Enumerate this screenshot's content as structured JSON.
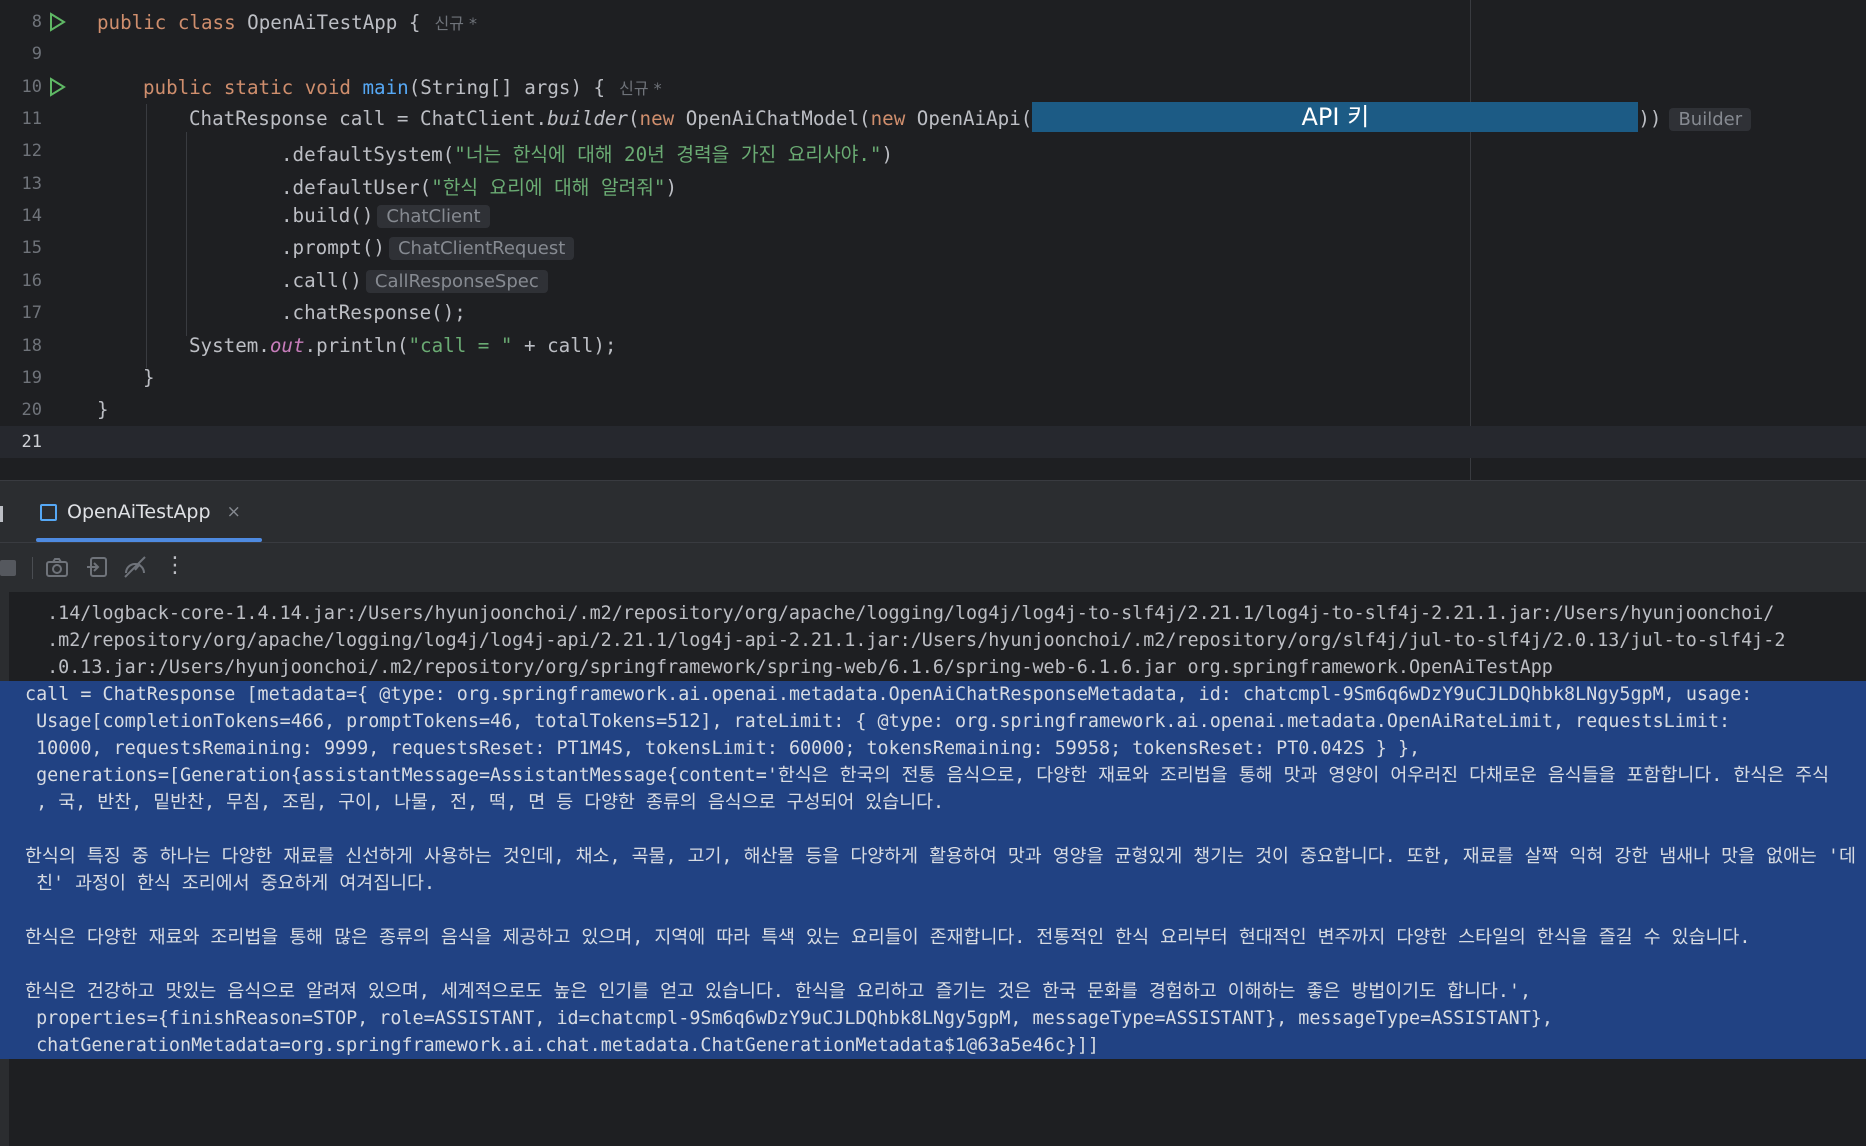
{
  "editor": {
    "lines": [
      {
        "num": "8",
        "run": true
      },
      {
        "num": "9"
      },
      {
        "num": "10",
        "run": true
      },
      {
        "num": "11"
      },
      {
        "num": "12"
      },
      {
        "num": "13"
      },
      {
        "num": "14"
      },
      {
        "num": "15"
      },
      {
        "num": "16"
      },
      {
        "num": "17"
      },
      {
        "num": "18"
      },
      {
        "num": "19"
      },
      {
        "num": "20"
      },
      {
        "num": "21",
        "current": true
      }
    ],
    "code": {
      "l8_kw": "public class",
      "l8_name": " OpenAiTestApp {",
      "l8_tag": "신규 *",
      "l10_kw": "public static void",
      "l10_fn": "main",
      "l10_rest": "(String[] args) {",
      "l10_tag": "신규 *",
      "l11_a": "ChatResponse call = ChatClient.",
      "l11_builder": "builder",
      "l11_b": "(",
      "l11_new1": "new",
      "l11_c": " OpenAiChatModel(",
      "l11_new2": "new",
      "l11_d": " OpenAiApi(",
      "l11_key": "API 키",
      "l11_e": "))",
      "l11_hint": "Builder",
      "l12_a": ".defaultSystem(",
      "l12_str": "\"너는 한식에 대해 20년 경력을 가진 요리사야.\"",
      "l12_b": ")",
      "l13_a": ".defaultUser(",
      "l13_str": "\"한식 요리에 대해 알려줘\"",
      "l13_b": ")",
      "l14_a": ".build()",
      "l14_hint": "ChatClient",
      "l15_a": ".prompt()",
      "l15_hint": "ChatClientRequest",
      "l16_a": ".call()",
      "l16_hint": "CallResponseSpec",
      "l17_a": ".chatResponse();",
      "l18_a": "System.",
      "l18_out": "out",
      "l18_b": ".println(",
      "l18_str": "\"call = \"",
      "l18_c": " + call);",
      "l19": "}",
      "l20": "}"
    }
  },
  "run_panel": {
    "tab_label": "OpenAiTestApp",
    "tab_close": "×",
    "toolbar_icons": [
      "stop-icon",
      "camera-icon",
      "exit-icon",
      "profiler-icon",
      "more-icon"
    ],
    "more_glyph": "⋮"
  },
  "console": {
    "lines": [
      {
        "text": " .14/logback-core-1.4.14.jar:/Users/hyunjoonchoi/.m2/repository/org/apache/logging/log4j/log4j-to-slf4j/2.21.1/log4j-to-slf4j-2.21.1.jar:/Users/hyunjoonchoi/",
        "sel": false
      },
      {
        "text": " .m2/repository/org/apache/logging/log4j/log4j-api/2.21.1/log4j-api-2.21.1.jar:/Users/hyunjoonchoi/.m2/repository/org/slf4j/jul-to-slf4j/2.0.13/jul-to-slf4j-2",
        "sel": false
      },
      {
        "text": " .0.13.jar:/Users/hyunjoonchoi/.m2/repository/org/springframework/spring-web/6.1.6/spring-web-6.1.6.jar org.springframework.OpenAiTestApp",
        "sel": false
      },
      {
        "text": "call = ChatResponse [metadata={ @type: org.springframework.ai.openai.metadata.OpenAiChatResponseMetadata, id: chatcmpl-9Sm6q6wDzY9uCJLDQhbk8LNgy5gpM, usage:",
        "sel": true
      },
      {
        "text": " Usage[completionTokens=466, promptTokens=46, totalTokens=512], rateLimit: { @type: org.springframework.ai.openai.metadata.OpenAiRateLimit, requestsLimit:",
        "sel": true
      },
      {
        "text": " 10000, requestsRemaining: 9999, requestsReset: PT1M4S, tokensLimit: 60000; tokensRemaining: 59958; tokensReset: PT0.042S } },",
        "sel": true
      },
      {
        "text": " generations=[Generation{assistantMessage=AssistantMessage{content='한식은 한국의 전통 음식으로, 다양한 재료와 조리법을 통해 맛과 영양이 어우러진 다채로운 음식들을 포함합니다. 한식은 주식",
        "sel": true
      },
      {
        "text": " , 국, 반찬, 밑반찬, 무침, 조림, 구이, 나물, 전, 떡, 면 등 다양한 종류의 음식으로 구성되어 있습니다.",
        "sel": true
      },
      {
        "text": "",
        "sel": true
      },
      {
        "text": "한식의 특징 중 하나는 다양한 재료를 신선하게 사용하는 것인데, 채소, 곡물, 고기, 해산물 등을 다양하게 활용하여 맛과 영양을 균형있게 챙기는 것이 중요합니다. 또한, 재료를 살짝 익혀 강한 냄새나 맛을 없애는 '데",
        "sel": true
      },
      {
        "text": " 친' 과정이 한식 조리에서 중요하게 여겨집니다.",
        "sel": true
      },
      {
        "text": "",
        "sel": true
      },
      {
        "text": "한식은 다양한 재료와 조리법을 통해 많은 종류의 음식을 제공하고 있으며, 지역에 따라 특색 있는 요리들이 존재합니다. 전통적인 한식 요리부터 현대적인 변주까지 다양한 스타일의 한식을 즐길 수 있습니다.",
        "sel": true
      },
      {
        "text": "",
        "sel": true
      },
      {
        "text": "한식은 건강하고 맛있는 음식으로 알려져 있으며, 세계적으로도 높은 인기를 얻고 있습니다. 한식을 요리하고 즐기는 것은 한국 문화를 경험하고 이해하는 좋은 방법이기도 합니다.',",
        "sel": true
      },
      {
        "text": " properties={finishReason=STOP, role=ASSISTANT, id=chatcmpl-9Sm6q6wDzY9uCJLDQhbk8LNgy5gpM, messageType=ASSISTANT}, messageType=ASSISTANT},",
        "sel": true
      },
      {
        "text": " chatGenerationMetadata=org.springframework.ai.chat.metadata.ChatGenerationMetadata$1@63a5e46c}]]",
        "sel": true
      }
    ]
  }
}
